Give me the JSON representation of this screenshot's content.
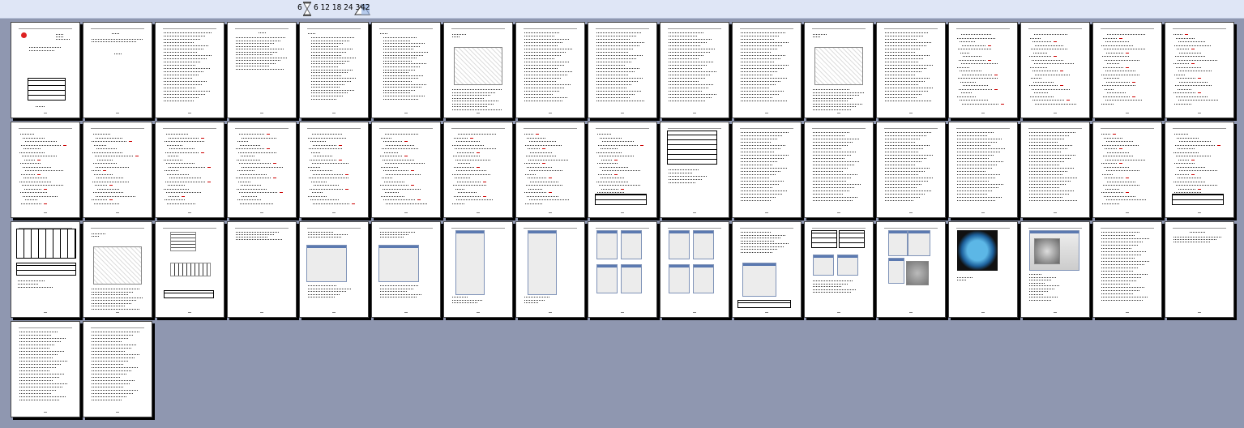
{
  "toolbar": {
    "left_value": "6",
    "zoom_options": "6 12 18 24 30",
    "page_count": "42",
    "hourglass_icon": "hourglass-icon",
    "zoom_icon": "zoom-mountain-icon"
  },
  "colors": {
    "background": "#8f97b0",
    "toolbar": "#dfe6f6",
    "page": "#ffffff"
  },
  "pages": [
    {
      "kind": "cover"
    },
    {
      "kind": "title"
    },
    {
      "kind": "text"
    },
    {
      "kind": "abstract"
    },
    {
      "kind": "toc"
    },
    {
      "kind": "toc"
    },
    {
      "kind": "drawing"
    },
    {
      "kind": "text"
    },
    {
      "kind": "text"
    },
    {
      "kind": "text"
    },
    {
      "kind": "text"
    },
    {
      "kind": "drawing"
    },
    {
      "kind": "text"
    },
    {
      "kind": "formula"
    },
    {
      "kind": "formula"
    },
    {
      "kind": "formula"
    },
    {
      "kind": "formula"
    },
    {
      "kind": "formula"
    },
    {
      "kind": "formula"
    },
    {
      "kind": "formula"
    },
    {
      "kind": "formula"
    },
    {
      "kind": "formula"
    },
    {
      "kind": "formula"
    },
    {
      "kind": "formula"
    },
    {
      "kind": "formula"
    },
    {
      "kind": "formula-table"
    },
    {
      "kind": "table"
    },
    {
      "kind": "text"
    },
    {
      "kind": "text"
    },
    {
      "kind": "text"
    },
    {
      "kind": "text"
    },
    {
      "kind": "text"
    },
    {
      "kind": "formula"
    },
    {
      "kind": "formula-table"
    },
    {
      "kind": "big-table"
    },
    {
      "kind": "mech-drawing"
    },
    {
      "kind": "mech-drawing2"
    },
    {
      "kind": "short-text"
    },
    {
      "kind": "dialog"
    },
    {
      "kind": "dialog"
    },
    {
      "kind": "dialog-tall"
    },
    {
      "kind": "dialog-tall"
    },
    {
      "kind": "dialog-grid"
    },
    {
      "kind": "dialog-grid"
    },
    {
      "kind": "dialog-text"
    },
    {
      "kind": "table-dialog"
    },
    {
      "kind": "dialog-3d"
    },
    {
      "kind": "render-blue"
    },
    {
      "kind": "render-gray"
    },
    {
      "kind": "text"
    },
    {
      "kind": "sparse"
    },
    {
      "kind": "text"
    },
    {
      "kind": "text"
    }
  ]
}
